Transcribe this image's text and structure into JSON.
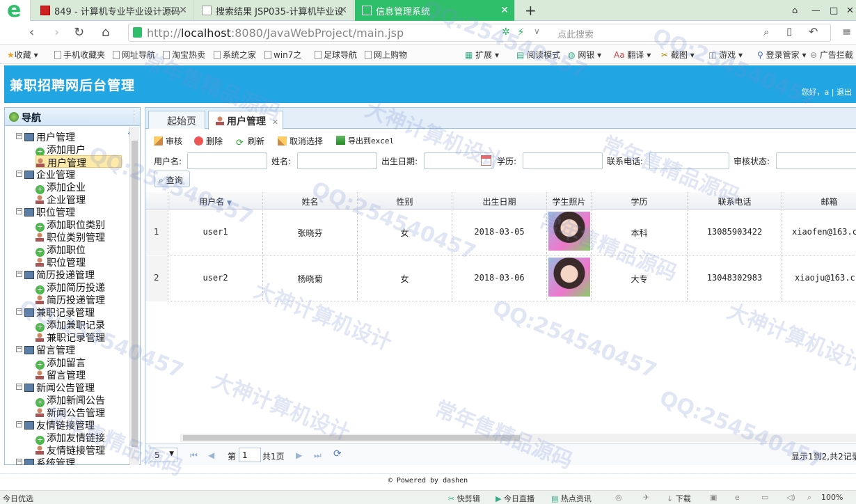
{
  "browser": {
    "tabs": [
      {
        "label": "849 - 计算机专业毕业设计源码"
      },
      {
        "label": "搜索结果 JSP035-计算机毕业设"
      },
      {
        "label": "信息管理系统"
      }
    ],
    "url_prefix": "http://",
    "url_host": "localhost",
    "url_rest": ":8080/JavaWebProject/main.jsp",
    "search_placeholder": "点此搜索",
    "bookmarks": [
      "收藏",
      "手机收藏夹",
      "网址导航",
      "淘宝热卖",
      "系统之家",
      "win7之",
      "足球导航",
      "网上购物"
    ],
    "tools": [
      "扩展",
      "阅读模式",
      "网银",
      "翻译",
      "截图",
      "游戏",
      "登录管家",
      "广告拦截"
    ]
  },
  "header": {
    "title": "兼职招聘网后台管理",
    "greeting": "您好，a",
    "logout": "退出"
  },
  "sidebar": {
    "title": "导航",
    "tree": [
      {
        "label": "用户管理",
        "level": 0
      },
      {
        "label": "添加用户",
        "level": 1,
        "icon": "add"
      },
      {
        "label": "用户管理",
        "level": 1,
        "icon": "user",
        "selected": true
      },
      {
        "label": "企业管理",
        "level": 0
      },
      {
        "label": "添加企业",
        "level": 1,
        "icon": "add"
      },
      {
        "label": "企业管理",
        "level": 1,
        "icon": "user"
      },
      {
        "label": "职位管理",
        "level": 0
      },
      {
        "label": "添加职位类别",
        "level": 1,
        "icon": "add"
      },
      {
        "label": "职位类别管理",
        "level": 1,
        "icon": "user"
      },
      {
        "label": "添加职位",
        "level": 1,
        "icon": "add"
      },
      {
        "label": "职位管理",
        "level": 1,
        "icon": "user"
      },
      {
        "label": "简历投递管理",
        "level": 0
      },
      {
        "label": "添加简历投递",
        "level": 1,
        "icon": "add"
      },
      {
        "label": "简历投递管理",
        "level": 1,
        "icon": "user"
      },
      {
        "label": "兼职记录管理",
        "level": 0
      },
      {
        "label": "添加兼职记录",
        "level": 1,
        "icon": "add"
      },
      {
        "label": "兼职记录管理",
        "level": 1,
        "icon": "user"
      },
      {
        "label": "留言管理",
        "level": 0
      },
      {
        "label": "添加留言",
        "level": 1,
        "icon": "add"
      },
      {
        "label": "留言管理",
        "level": 1,
        "icon": "user"
      },
      {
        "label": "新闻公告管理",
        "level": 0
      },
      {
        "label": "添加新闻公告",
        "level": 1,
        "icon": "add"
      },
      {
        "label": "新闻公告管理",
        "level": 1,
        "icon": "user"
      },
      {
        "label": "友情链接管理",
        "level": 0
      },
      {
        "label": "添加友情链接",
        "level": 1,
        "icon": "add"
      },
      {
        "label": "友情链接管理",
        "level": 1,
        "icon": "user"
      },
      {
        "label": "系统管理",
        "level": 0
      }
    ]
  },
  "panel_tabs": [
    {
      "label": "起始页"
    },
    {
      "label": "用户管理",
      "active": true
    }
  ],
  "toolbar": {
    "audit": "审核",
    "delete": "删除",
    "refresh": "刷新",
    "unselect": "取消选择",
    "export": "导出到excel"
  },
  "search": {
    "username": "用户名:",
    "name": "姓名:",
    "birth": "出生日期:",
    "education": "学历:",
    "phone": "联系电话:",
    "status": "审核状态:",
    "query": "查询"
  },
  "grid": {
    "columns": [
      "用户名",
      "姓名",
      "性别",
      "出生日期",
      "学生照片",
      "学历",
      "联系电话",
      "邮箱"
    ],
    "rows": [
      {
        "n": "1",
        "user": "user1",
        "name": "张晓芬",
        "sex": "女",
        "birth": "2018-03-05",
        "edu": "本科",
        "phone": "13085903422",
        "email": "xiaofen@163.c"
      },
      {
        "n": "2",
        "user": "user2",
        "name": "杨晓菊",
        "sex": "女",
        "birth": "2018-03-06",
        "edu": "大专",
        "phone": "13048302983",
        "email": "xiaoju@163.c"
      }
    ]
  },
  "pager": {
    "page_size": "5",
    "page_prefix": "第",
    "page": "1",
    "page_total": "共1页",
    "summary": "显示1到2,共2记录"
  },
  "footer": "© Powered by dashen",
  "statusbar": {
    "left": "今日优选",
    "items": [
      "快剪辑",
      "今日直播",
      "热点资讯",
      "下载",
      "100%"
    ]
  },
  "watermarks": [
    "常年售精品源码",
    "大神计算机设计",
    "QQ:254540457"
  ]
}
